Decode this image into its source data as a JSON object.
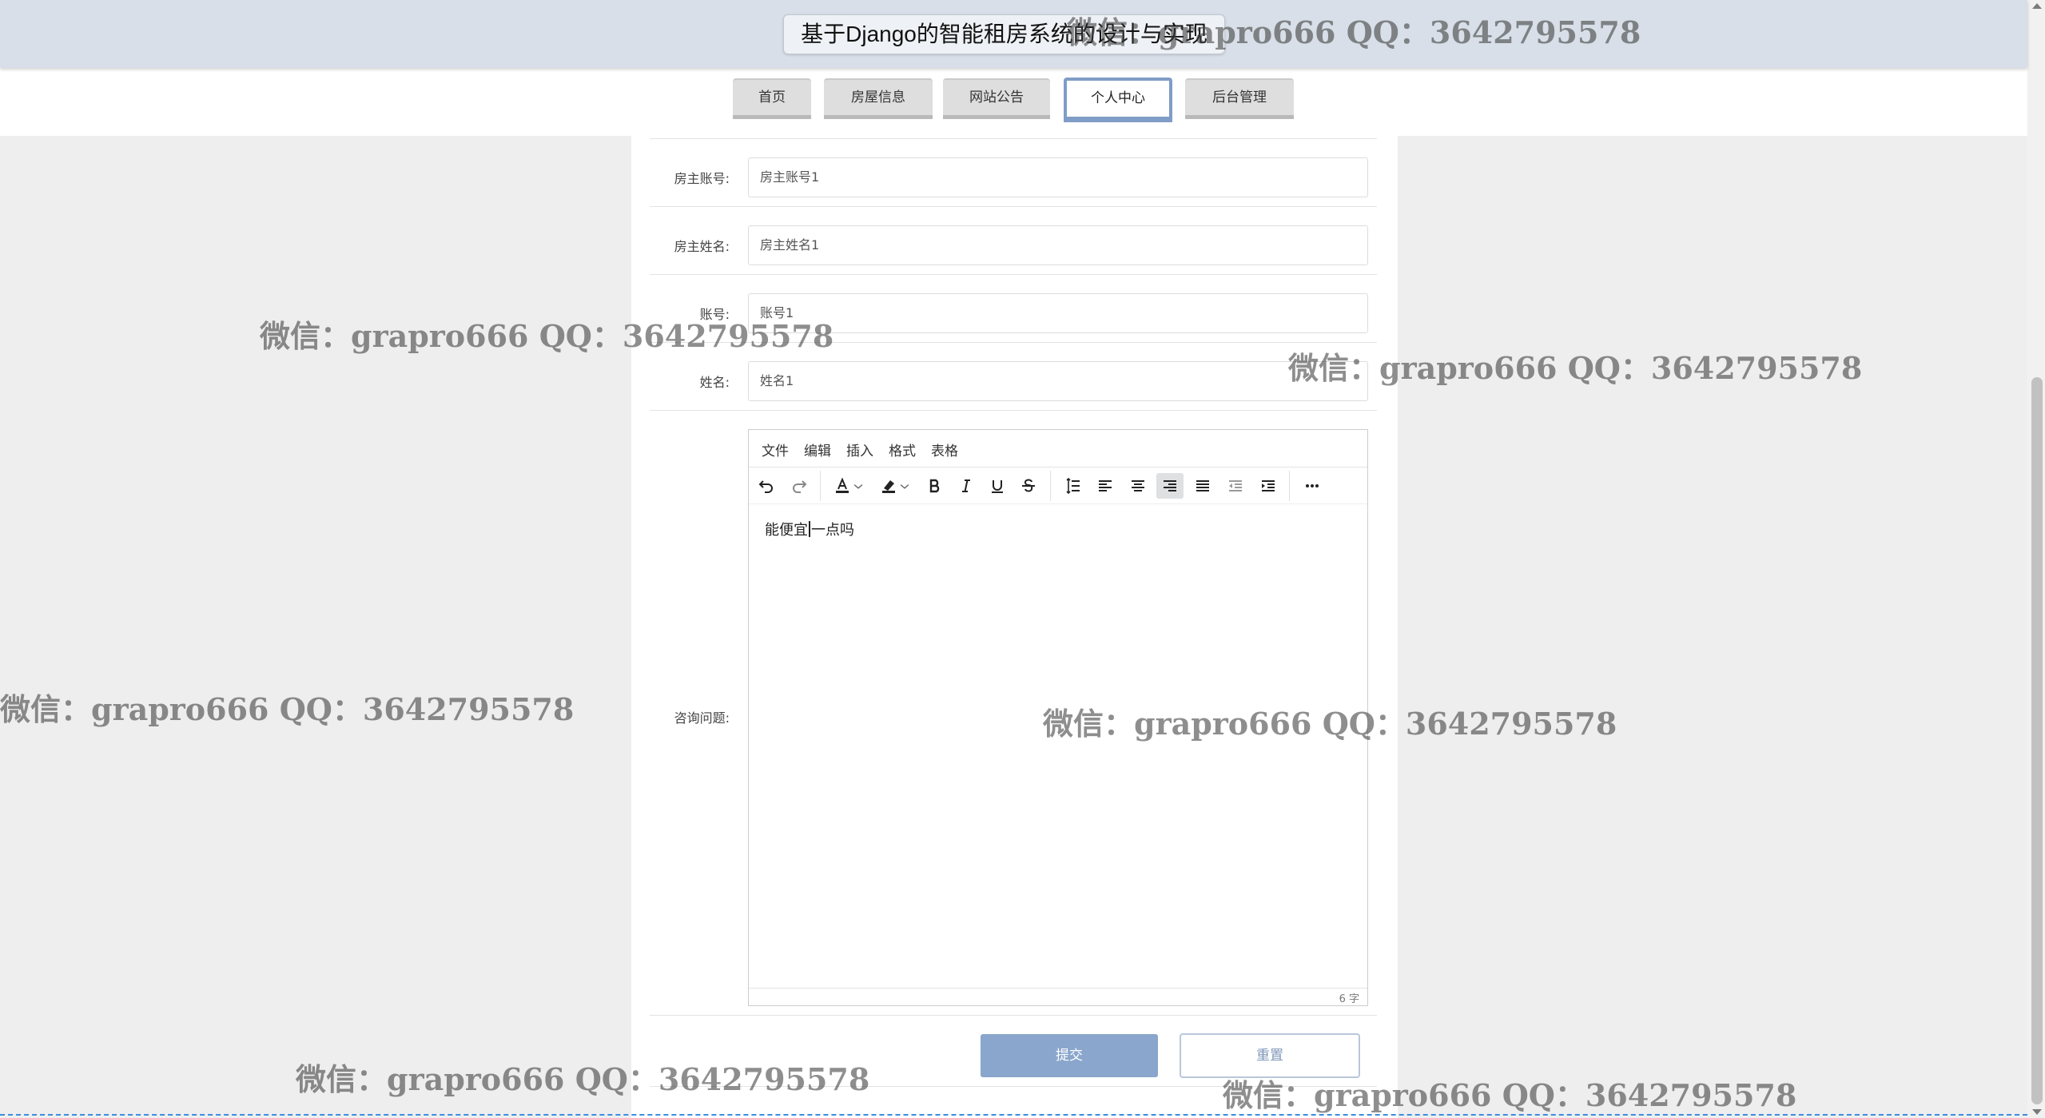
{
  "header": {
    "title": "基于Django的智能租房系统的设计与实现"
  },
  "nav": {
    "items": [
      "首页",
      "房屋信息",
      "网站公告",
      "个人中心",
      "后台管理"
    ],
    "active_index": 3
  },
  "form": {
    "fields": [
      {
        "label": "房主账号:",
        "value": "房主账号1"
      },
      {
        "label": "房主姓名:",
        "value": "房主姓名1"
      },
      {
        "label": "账号:",
        "value": "账号1"
      },
      {
        "label": "姓名:",
        "value": "姓名1"
      }
    ],
    "question_label": "咨询问题:",
    "editor": {
      "menu": [
        "文件",
        "编辑",
        "插入",
        "格式",
        "表格"
      ],
      "toolbar_icons": [
        "undo-icon",
        "redo-icon",
        "text-color-icon",
        "highlight-icon",
        "bold-icon",
        "italic-icon",
        "underline-icon",
        "strikethrough-icon",
        "line-height-icon",
        "align-left-icon",
        "align-center-icon",
        "align-right-icon",
        "align-justify-icon",
        "outdent-icon",
        "indent-icon",
        "more-icon"
      ],
      "content_before_caret": "能便宜",
      "content_after_caret": "一点吗",
      "word_count": "6 字"
    },
    "submit_label": "提交",
    "reset_label": "重置"
  },
  "watermark": {
    "text": "微信：grapro666 QQ：3642795578"
  },
  "colors": {
    "accent": "#8aa6cc",
    "header_bg": "#d8dfe8",
    "page_bg": "#eeeeee",
    "active_tab_border": "#7f9dc7"
  }
}
